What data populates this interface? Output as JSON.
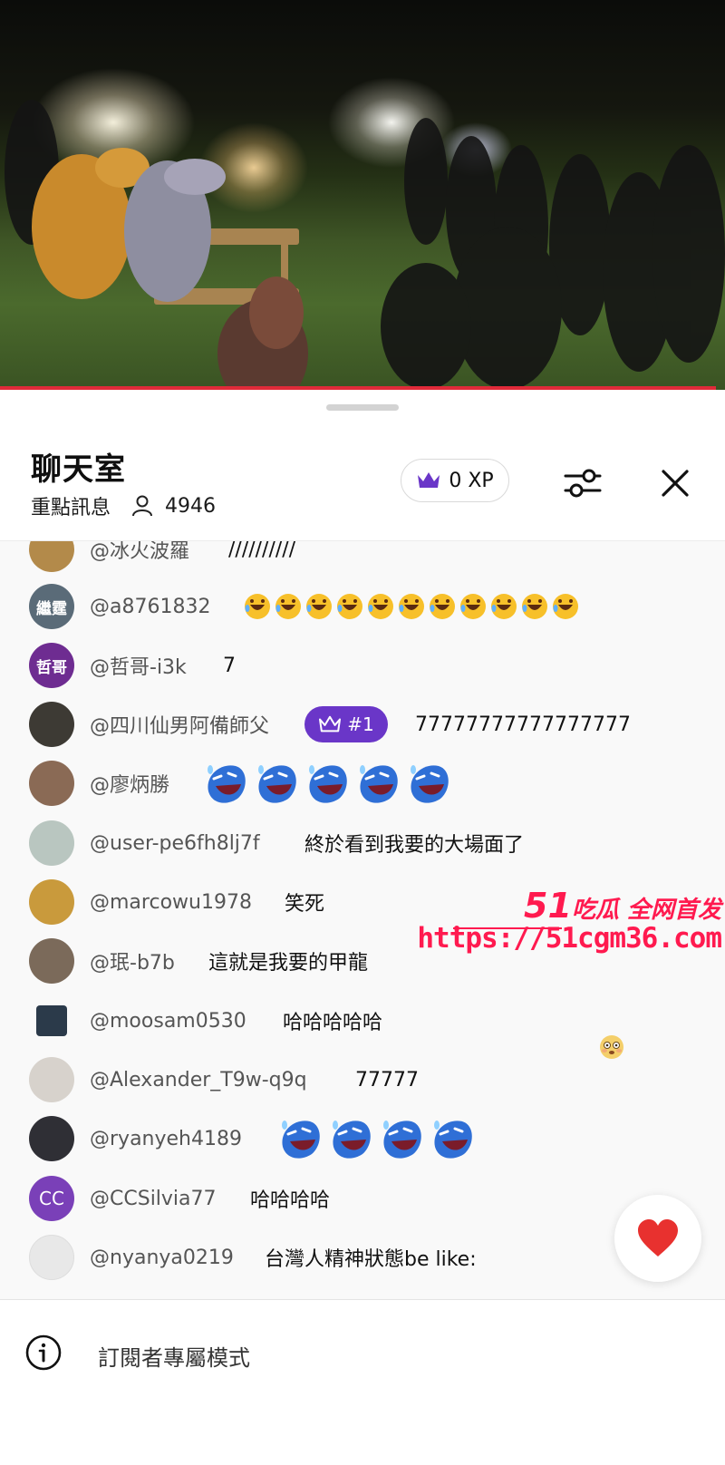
{
  "chat": {
    "title": "聊天室",
    "mode": "重點訊息",
    "viewer_count": "4946",
    "xp": "0 XP"
  },
  "messages": [
    {
      "author": "@冰火波羅",
      "text": "//////////",
      "avatar": {
        "kind": "photo",
        "color": "#b38a4a"
      }
    },
    {
      "author": "@a8761832",
      "text": "",
      "emoji": "rolling-on-floor-laughing",
      "emoji_count": 11,
      "avatar": {
        "kind": "text",
        "label": "繼霆",
        "color": "#5a6b78"
      }
    },
    {
      "author": "@哲哥-i3k",
      "text": "7",
      "avatar": {
        "kind": "text",
        "label": "哲哥",
        "color": "#6e2c91"
      }
    },
    {
      "author": "@四川仙男阿備師父",
      "text": "77777777777777777",
      "badge": "#1",
      "avatar": {
        "kind": "photo",
        "color": "#3d3a34"
      }
    },
    {
      "author": "@廖炳勝",
      "text": "",
      "emoji": "laughing-blob",
      "emoji_count": 5,
      "avatar": {
        "kind": "photo",
        "color": "#8a6a55"
      }
    },
    {
      "author": "@user-pe6fh8lj7f",
      "text": "終於看到我要的大場面了",
      "avatar": {
        "kind": "photo",
        "color": "#b9c6c0"
      }
    },
    {
      "author": "@marcowu1978",
      "text": "笑死",
      "avatar": {
        "kind": "photo",
        "color": "#c99a3c"
      }
    },
    {
      "author": "@珉-b7b",
      "text": "這就是我要的甲龍",
      "avatar": {
        "kind": "photo",
        "color": "#7b6a5a"
      }
    },
    {
      "author": "@moosam0530",
      "text": "哈哈哈哈哈",
      "avatar": {
        "kind": "photo",
        "color": "#2b3a4a"
      }
    },
    {
      "author": "@Alexander_T9w-q9q",
      "text": "77777",
      "avatar": {
        "kind": "photo",
        "color": "#d7d2cc"
      }
    },
    {
      "author": "@ryanyeh4189",
      "text": "",
      "emoji": "laughing-blob",
      "emoji_count": 4,
      "avatar": {
        "kind": "photo",
        "color": "#2f2f35"
      }
    },
    {
      "author": "@CCSilvia77",
      "text": "哈哈哈哈",
      "avatar": {
        "kind": "text",
        "label": "CC",
        "color": "#7a40b8"
      }
    },
    {
      "author": "@nyanya0219",
      "text": "台灣人精神狀態be like:",
      "avatar": {
        "kind": "photo",
        "color": "#e8e8e8"
      }
    }
  ],
  "watermark": {
    "line1_big": "51",
    "line1": "吃瓜 全网首发",
    "line2": "https://51cgm36.com"
  },
  "footer": {
    "text": "訂閱者專屬模式"
  },
  "colors": {
    "accent_purple": "#6a36c8",
    "progress_red": "#e02a39",
    "heart_red": "#e8312f",
    "watermark_pink": "#ff1a4f"
  },
  "icons": [
    "crown-icon",
    "sliders-icon",
    "close-icon",
    "person-icon",
    "info-icon",
    "heart-icon"
  ]
}
